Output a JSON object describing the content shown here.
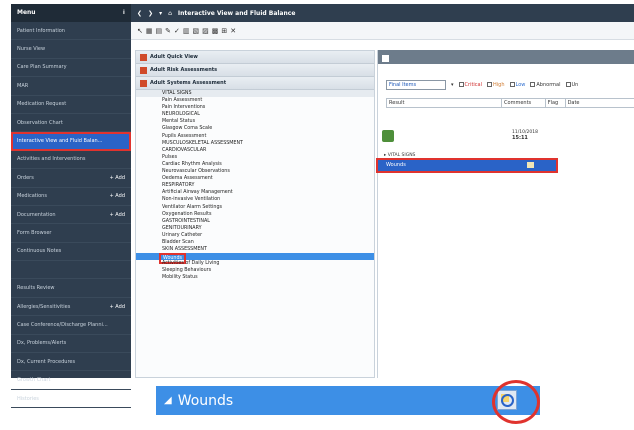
{
  "sidebar": {
    "header": "Menu",
    "items": [
      {
        "label": "Patient Information",
        "add": ""
      },
      {
        "label": "Nurse View",
        "add": ""
      },
      {
        "label": "Care Plan Summary",
        "add": ""
      },
      {
        "label": "MAR",
        "add": ""
      },
      {
        "label": "Medication Request",
        "add": ""
      },
      {
        "label": "Observation Chart",
        "add": ""
      },
      {
        "label": "Interactive View and Fluid Balan...",
        "add": "",
        "selected": true
      },
      {
        "label": "Activities and Interventions",
        "add": ""
      },
      {
        "label": "Orders",
        "add": "+ Add"
      },
      {
        "label": "Medications",
        "add": "+ Add"
      },
      {
        "label": "Documentation",
        "add": "+ Add"
      },
      {
        "label": "Form Browser",
        "add": ""
      },
      {
        "label": "Continuous Notes",
        "add": ""
      },
      {
        "label": "",
        "add": ""
      },
      {
        "label": "Results Review",
        "add": ""
      },
      {
        "label": "Allergies/Sensitivities",
        "add": "+ Add"
      },
      {
        "label": "Case Conference/Discharge Planni...",
        "add": ""
      },
      {
        "label": "Dx, Problems/Alerts",
        "add": ""
      },
      {
        "label": "Dx, Current Procedures",
        "add": ""
      },
      {
        "label": "Growth Chart",
        "add": ""
      },
      {
        "label": "Histories",
        "add": ""
      }
    ]
  },
  "topbar": {
    "title": "Interactive View and Fluid Balance"
  },
  "tree": {
    "bands": [
      "Adult Quick View",
      "Adult Risk Assessments",
      "Adult Systems Assessment"
    ],
    "sections": [
      {
        "label": "VITAL SIGNS",
        "head": true
      },
      {
        "label": "Pain Assessment"
      },
      {
        "label": "Pain Interventions"
      },
      {
        "label": "NEUROLOGICAL"
      },
      {
        "label": "Mental Status"
      },
      {
        "label": "Glasgow Coma Scale"
      },
      {
        "label": "Pupils Assessment"
      },
      {
        "label": "MUSCULOSKELETAL ASSESSMENT"
      },
      {
        "label": "CARDIOVASCULAR"
      },
      {
        "label": "Pulses"
      },
      {
        "label": "Cardiac Rhythm Analysis"
      },
      {
        "label": "Neurovascular Observations"
      },
      {
        "label": "Oedema Assessment"
      },
      {
        "label": "RESPIRATORY"
      },
      {
        "label": "Artificial Airway Management"
      },
      {
        "label": "Non-invasive Ventilation"
      },
      {
        "label": "Ventilator Alarm Settings"
      },
      {
        "label": "Oxygenation Results"
      },
      {
        "label": "GASTROINTESTINAL"
      },
      {
        "label": "GENITOURINARY"
      },
      {
        "label": "Urinary Catheter"
      },
      {
        "label": "Bladder Scan"
      },
      {
        "label": "SKIN ASSESSMENT"
      },
      {
        "label": "Wounds",
        "highlight": true
      },
      {
        "label": "Activities of Daily Living"
      },
      {
        "label": "Sleeping Behaviours"
      },
      {
        "label": "Mobility Status"
      }
    ]
  },
  "right": {
    "select_value": "Final Items",
    "filters": [
      "Critical",
      "High",
      "Low",
      "Abnormal",
      "Un"
    ],
    "columns": [
      "Result",
      "Comments",
      "Flag",
      "Date"
    ],
    "date": "11/10/2018",
    "time": "15:11",
    "vital_signs": "VITAL SIGNS",
    "wounds": "Wounds"
  },
  "zoom": {
    "label": "Wounds"
  },
  "colors": {
    "accent": "#3d8fe6",
    "highlight_outline": "#e0332e",
    "sidebar_bg": "#2f3e4f"
  }
}
